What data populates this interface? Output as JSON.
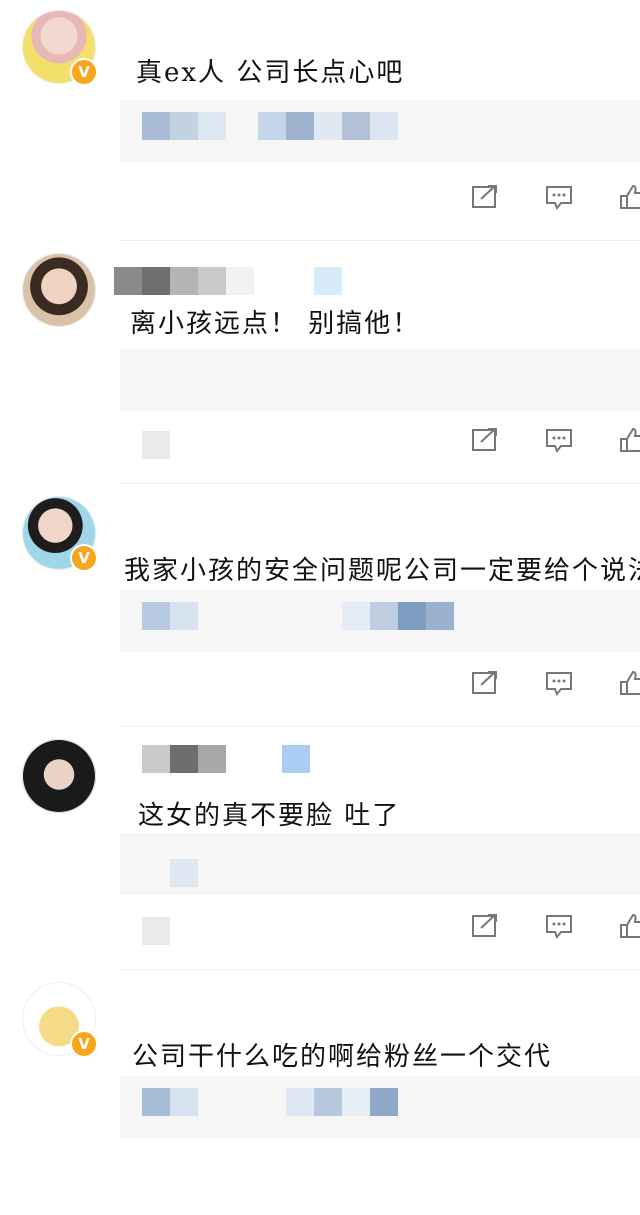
{
  "comments": [
    {
      "text": "真ex人 公司长点心吧",
      "verified": true,
      "badge": "V"
    },
    {
      "text": "离小孩远点！ 别搞他！",
      "verified": false
    },
    {
      "text": "我家小孩的安全问题呢公司一定要给个说法",
      "verified": true,
      "badge": "V"
    },
    {
      "text": "这女的真不要脸 吐了",
      "verified": false
    },
    {
      "text": "公司干什么吃的啊给粉丝一个交代",
      "verified": true,
      "badge": "V"
    }
  ],
  "icons": {
    "share": "share-icon",
    "comment": "comment-icon",
    "like": "like-icon"
  },
  "colors": {
    "badge": "#f7a51a",
    "reply_bg": "#f6f6f6",
    "pixel_blue": "#7f9dc0",
    "pixel_gray": "#8a8a8a"
  }
}
